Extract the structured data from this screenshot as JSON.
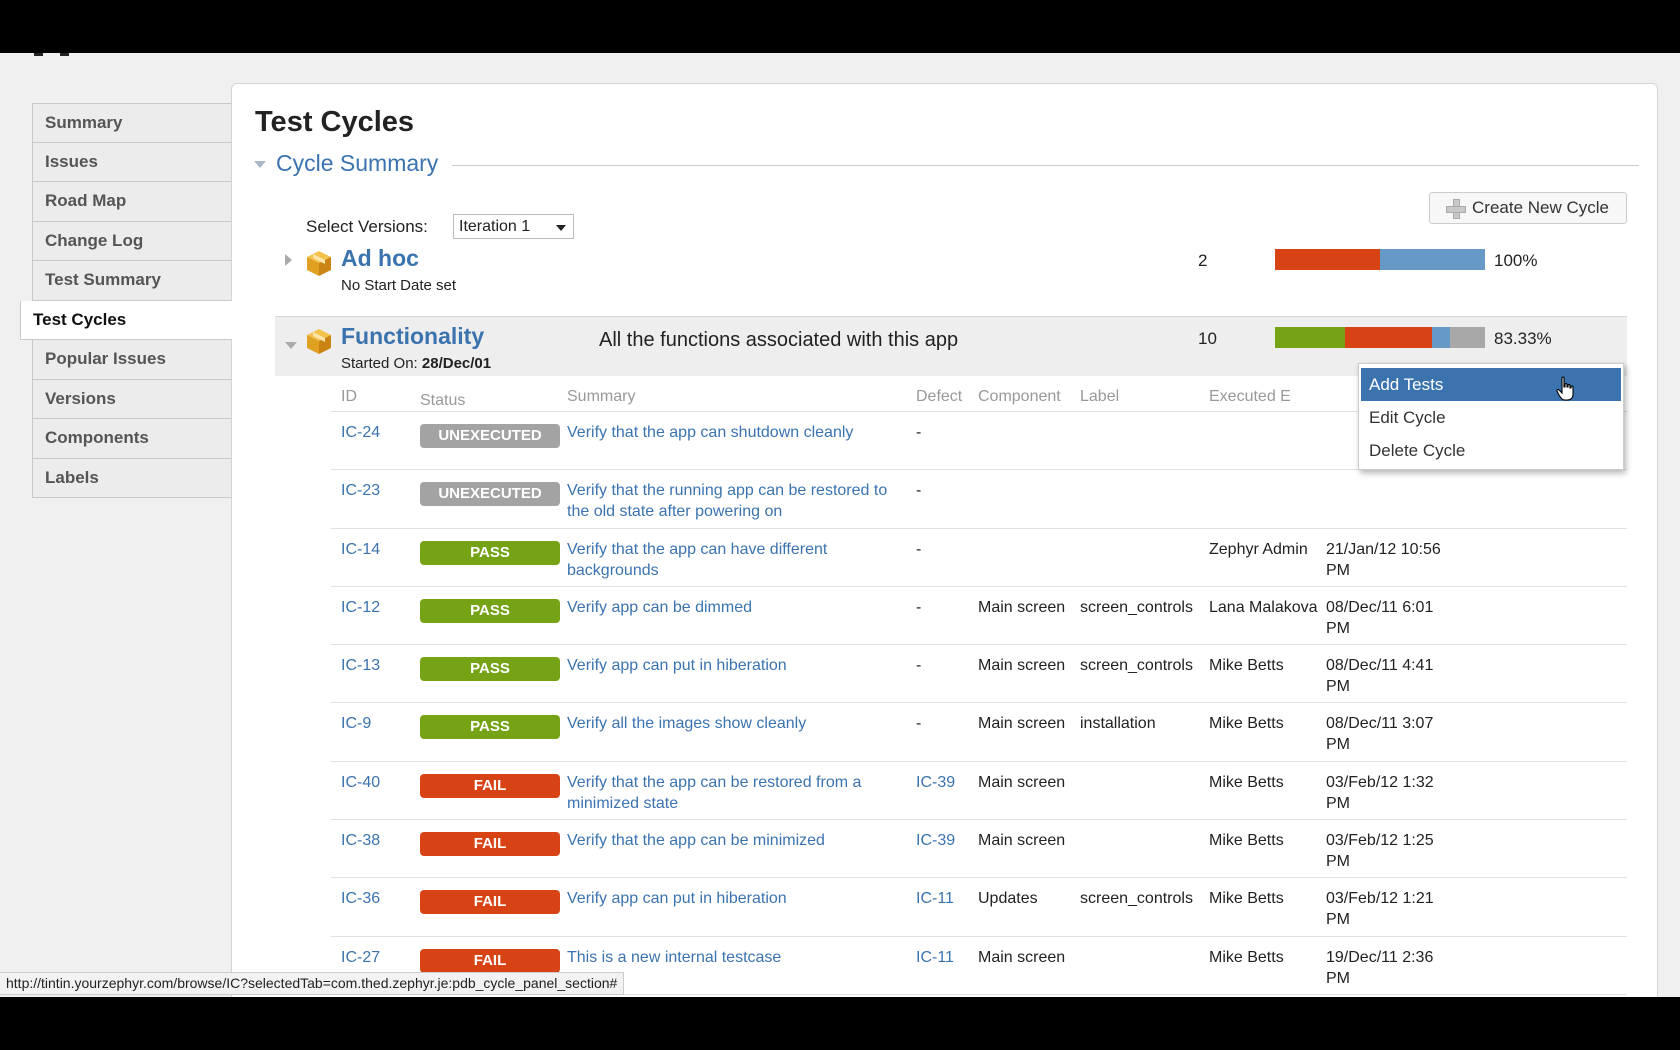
{
  "page_title": "Test Cycles",
  "section_title": "Cycle Summary",
  "sidebar": {
    "items": [
      {
        "label": "Summary"
      },
      {
        "label": "Issues"
      },
      {
        "label": "Road Map"
      },
      {
        "label": "Change Log"
      },
      {
        "label": "Test Summary"
      },
      {
        "label": "Test Cycles",
        "active": true
      },
      {
        "label": "Popular Issues"
      },
      {
        "label": "Versions"
      },
      {
        "label": "Components"
      },
      {
        "label": "Labels"
      }
    ]
  },
  "versions": {
    "label": "Select Versions:",
    "selected": "Iteration 1"
  },
  "create_button": {
    "label": "Create New Cycle"
  },
  "cycles": {
    "adhoc": {
      "name": "Ad hoc",
      "subtitle": "No Start Date set",
      "count": "2",
      "percent": "100%",
      "progress": [
        {
          "color": "#d84315",
          "fraction": 0.5
        },
        {
          "color": "#6699c6",
          "fraction": 0.5
        }
      ]
    },
    "functionality": {
      "name": "Functionality",
      "started_label": "Started On:",
      "started_date": "28/Dec/01",
      "description": "All the functions associated with this app",
      "count": "10",
      "percent": "83.33%",
      "progress": [
        {
          "color": "#76a316",
          "fraction": 0.333
        },
        {
          "color": "#d84315",
          "fraction": 0.417
        },
        {
          "color": "#6699c6",
          "fraction": 0.083
        },
        {
          "color": "#a8a8a8",
          "fraction": 0.167
        }
      ]
    }
  },
  "table": {
    "headers": {
      "id": "ID",
      "status": "Status",
      "summary": "Summary",
      "defect": "Defect",
      "component": "Component",
      "label": "Label",
      "executed_by": "Executed E"
    },
    "rows": [
      {
        "id": "IC-24",
        "status": "UNEXECUTED",
        "summary": "Verify that the app can shutdown cleanly",
        "defect": "-",
        "component": "",
        "label": "",
        "executed_by": "",
        "date": ""
      },
      {
        "id": "IC-23",
        "status": "UNEXECUTED",
        "summary": "Verify that the running app can be restored to the old state after powering on",
        "defect": "-",
        "component": "",
        "label": "",
        "executed_by": "",
        "date": ""
      },
      {
        "id": "IC-14",
        "status": "PASS",
        "summary": "Verify that the app can have different backgrounds",
        "defect": "-",
        "component": "",
        "label": "",
        "executed_by": "Zephyr Admin",
        "date": "21/Jan/12 10:56 PM"
      },
      {
        "id": "IC-12",
        "status": "PASS",
        "summary": "Verify app can be dimmed",
        "defect": "-",
        "component": "Main screen",
        "label": "screen_controls",
        "executed_by": "Lana Malakova",
        "date": "08/Dec/11 6:01 PM"
      },
      {
        "id": "IC-13",
        "status": "PASS",
        "summary": "Verify app can put in hiberation",
        "defect": "-",
        "component": "Main screen",
        "label": "screen_controls",
        "executed_by": "Mike Betts",
        "date": "08/Dec/11 4:41 PM"
      },
      {
        "id": "IC-9",
        "status": "PASS",
        "summary": "Verify all the images show cleanly",
        "defect": "-",
        "component": "Main screen",
        "label": "installation",
        "executed_by": "Mike Betts",
        "date": "08/Dec/11 3:07 PM"
      },
      {
        "id": "IC-40",
        "status": "FAIL",
        "summary": "Verify that the app can be restored from a minimized state",
        "defect": "IC-39",
        "component": "Main screen",
        "label": "",
        "executed_by": "Mike Betts",
        "date": "03/Feb/12 1:32 PM"
      },
      {
        "id": "IC-38",
        "status": "FAIL",
        "summary": "Verify that the app can be minimized",
        "defect": "IC-39",
        "component": "Main screen",
        "label": "",
        "executed_by": "Mike Betts",
        "date": "03/Feb/12 1:25 PM"
      },
      {
        "id": "IC-36",
        "status": "FAIL",
        "summary": "Verify app can put in hiberation",
        "defect": "IC-11",
        "component": "Updates",
        "label": "screen_controls",
        "executed_by": "Mike Betts",
        "date": "03/Feb/12 1:21 PM"
      },
      {
        "id": "IC-27",
        "status": "FAIL",
        "summary": "This is a new internal testcase",
        "defect": "IC-11",
        "component": "Main screen",
        "label": "",
        "executed_by": "Mike Betts",
        "date": "19/Dec/11 2:36 PM"
      }
    ]
  },
  "status_colors": {
    "UNEXECUTED": "#a3a3a3",
    "PASS": "#76a316",
    "FAIL": "#d84315"
  },
  "context_menu": {
    "items": [
      "Add Tests",
      "Edit Cycle",
      "Delete Cycle"
    ],
    "highlighted": "Add Tests"
  },
  "status_bar": {
    "url": "http://tintin.yourzephyr.com/browse/IC?selectedTab=com.thed.zephyr.je:pdb_cycle_panel_section#"
  },
  "icons": {
    "cycle": "package-box-icon",
    "create": "plus-icon",
    "cursor": "hand-pointer-icon"
  }
}
